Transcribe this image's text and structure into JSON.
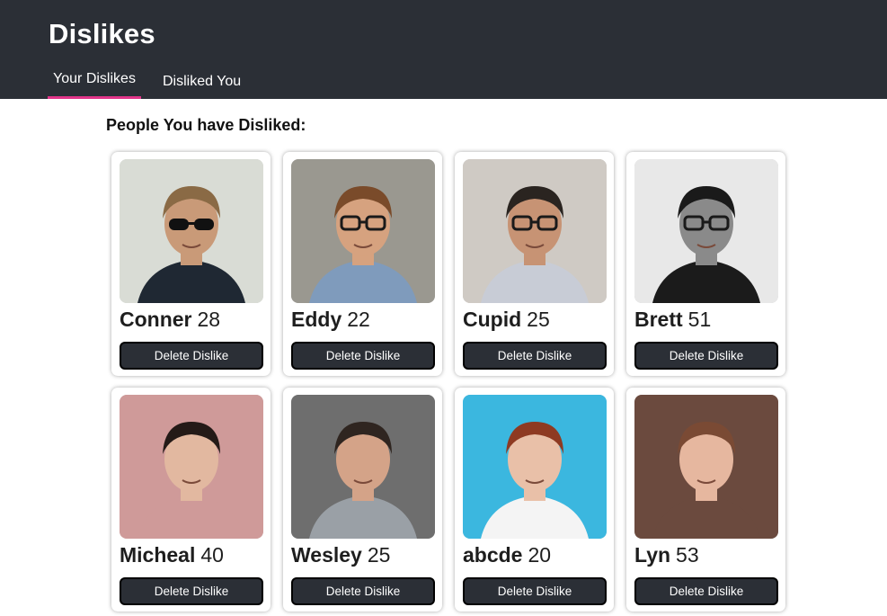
{
  "header": {
    "title": "Dislikes",
    "tabs": [
      {
        "label": "Your Dislikes",
        "active": true
      },
      {
        "label": "Disliked You",
        "active": false
      }
    ],
    "accent_color": "#e2358a",
    "background_color": "#2b2f36"
  },
  "main": {
    "heading": "People You have Disliked:",
    "button_label": "Delete Dislike",
    "profiles": [
      {
        "name": "Conner",
        "age": "28",
        "photo_bg": "#d9dcd5",
        "skin": "#c99a78",
        "hair": "#8a6a45",
        "shirt": "#1f2833",
        "glasses": "sunglasses"
      },
      {
        "name": "Eddy",
        "age": "22",
        "photo_bg": "#9a9890",
        "skin": "#d6a27f",
        "hair": "#7a4b2a",
        "shirt": "#7f9bbc",
        "glasses": "clear"
      },
      {
        "name": "Cupid",
        "age": "25",
        "photo_bg": "#cfcac4",
        "skin": "#c79374",
        "hair": "#2a2420",
        "shirt": "#c8ccd6",
        "glasses": "clear"
      },
      {
        "name": "Brett",
        "age": "51",
        "photo_bg": "#e8e8e8",
        "skin": "#8a8a8a",
        "hair": "#1a1a1a",
        "shirt": "#1b1b1b",
        "glasses": "clear"
      },
      {
        "name": "Micheal",
        "age": "40",
        "photo_bg": "#cf9a99",
        "skin": "#e2b8a0",
        "hair": "#241a17",
        "shirt": "#cf9a99",
        "glasses": "none"
      },
      {
        "name": "Wesley",
        "age": "25",
        "photo_bg": "#6e6e6e",
        "skin": "#d4a388",
        "hair": "#2f2520",
        "shirt": "#9aa0a6",
        "glasses": "none"
      },
      {
        "name": "abcde",
        "age": "20",
        "photo_bg": "#3bb7df",
        "skin": "#e9c0a8",
        "hair": "#8e3a22",
        "shirt": "#f4f4f4",
        "glasses": "none"
      },
      {
        "name": "Lyn",
        "age": "53",
        "photo_bg": "#6b4a3e",
        "skin": "#e6b79f",
        "hair": "#7a4a34",
        "shirt": "#6b4a3e",
        "glasses": "none"
      }
    ]
  }
}
